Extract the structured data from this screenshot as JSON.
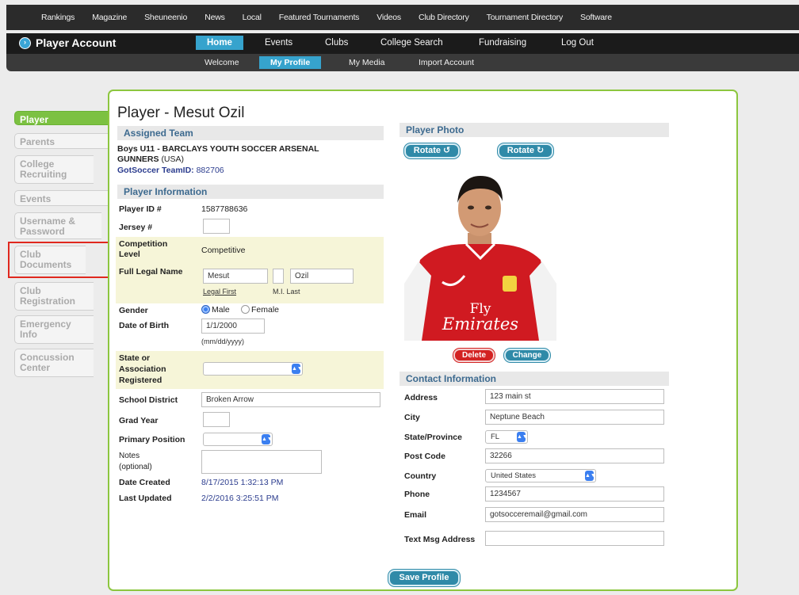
{
  "topnav": [
    "Rankings",
    "Magazine",
    "Sheuneenio",
    "News",
    "Local",
    "Featured Tournaments",
    "Videos",
    "Club Directory",
    "Tournament Directory",
    "Software"
  ],
  "account": {
    "title": "Player Account",
    "icon": "arrow-circle-icon"
  },
  "mainnav": [
    "Home",
    "Events",
    "Clubs",
    "College Search",
    "Fundraising",
    "Log Out"
  ],
  "subnav": [
    "Welcome",
    "My Profile",
    "My Media",
    "Import Account"
  ],
  "sidebar": [
    "Player",
    "Parents",
    "College Recruiting",
    "Events",
    "Username & Password",
    "Club Documents",
    "Club Registration",
    "Emergency Info",
    "Concussion Center"
  ],
  "page_title": "Player - Mesut Ozil",
  "assigned_team": {
    "header": "Assigned Team",
    "team_line1": "Boys U11 - BARCLAYS YOUTH SOCCER ARSENAL",
    "team_line2": "GUNNERS",
    "team_country": "(USA)",
    "teamid_label": "GotSoccer TeamID:",
    "teamid_value": "882706"
  },
  "player_info": {
    "header": "Player Information",
    "player_id_label": "Player ID #",
    "player_id_value": "1587788636",
    "jersey_label": "Jersey #",
    "jersey_value": "",
    "competition_label_1": "Competition",
    "competition_label_2": "Level",
    "competition_value": "Competitive",
    "legal_name_label": "Full Legal Name",
    "first_name": "Mesut",
    "mi": "",
    "last_name": "Ozil",
    "first_caption": "Legal First",
    "mi_caption": "M.I. Last",
    "gender_label": "Gender",
    "gender_male": "Male",
    "gender_female": "Female",
    "dob_label": "Date of Birth",
    "dob_value": "1/1/2000",
    "dob_hint": "(mm/dd/yyyy)",
    "state_label_1": "State or",
    "state_label_2": "Association",
    "state_label_3": "Registered",
    "state_value": "",
    "school_label": "School District",
    "school_value": "Broken Arrow",
    "grad_label": "Grad Year",
    "grad_value": "",
    "position_label": "Primary Position",
    "position_value": "",
    "notes_label_1": "Notes",
    "notes_label_2": "(optional)",
    "notes_value": "",
    "created_label": "Date Created",
    "created_value": "8/17/2015 1:32:13 PM",
    "updated_label": "Last Updated",
    "updated_value": "2/2/2016 3:25:51 PM"
  },
  "photo": {
    "header": "Player Photo",
    "rotate_left": "Rotate ↺",
    "rotate_right": "Rotate ↻",
    "delete": "Delete",
    "change": "Change",
    "shirt_sponsor_1": "Fly",
    "shirt_sponsor_2": "Emirates"
  },
  "contact": {
    "header": "Contact Information",
    "address_label": "Address",
    "address_value": "123 main st",
    "city_label": "City",
    "city_value": "Neptune Beach",
    "state_label": "State/Province",
    "state_value": "FL",
    "post_label": "Post Code",
    "post_value": "32266",
    "country_label": "Country",
    "country_value": "United States",
    "phone_label": "Phone",
    "phone_value": "1234567",
    "email_label": "Email",
    "email_value": "gotsocceremail@gmail.com",
    "textmsg_label": "Text Msg Address",
    "textmsg_value": ""
  },
  "save_label": "Save Profile",
  "colors": {
    "accent_green": "#8cc63f",
    "nav_blue": "#36a3cd",
    "highlight_red": "#e0281e"
  }
}
